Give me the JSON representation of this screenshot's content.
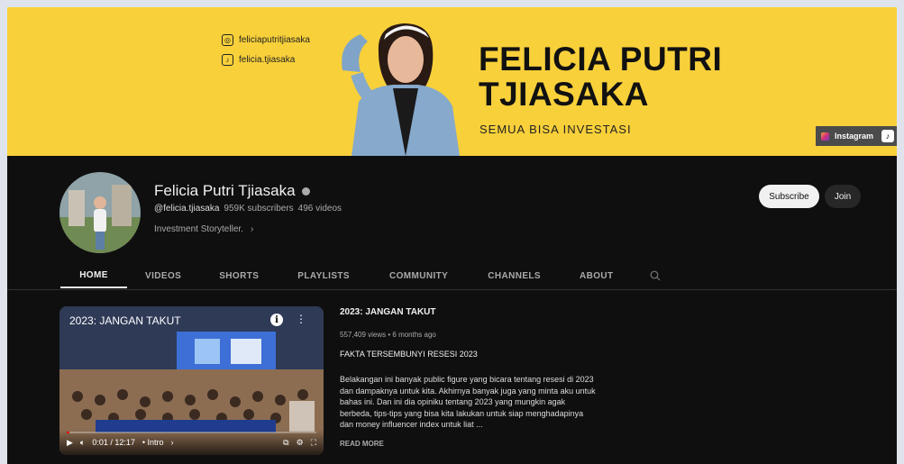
{
  "banner": {
    "instagram_handle": "feliciaputritjiasaka",
    "tiktok_handle": "felicia.tjiasaka",
    "title_line1": "FELICIA PUTRI",
    "title_line2": "TJIASAKA",
    "tagline": "SEMUA BISA INVESTASI",
    "link_label": "Instagram",
    "background_color": "#f8d03a"
  },
  "channel": {
    "name": "Felicia Putri Tjiasaka",
    "handle": "@felicia.tjiasaka",
    "subscribers": "959K subscribers",
    "videos": "496 videos",
    "description": "Investment Storyteller.",
    "subscribe_label": "Subscribe",
    "join_label": "Join"
  },
  "tabs": [
    {
      "label": "HOME",
      "active": true
    },
    {
      "label": "VIDEOS",
      "active": false
    },
    {
      "label": "SHORTS",
      "active": false
    },
    {
      "label": "PLAYLISTS",
      "active": false
    },
    {
      "label": "COMMUNITY",
      "active": false
    },
    {
      "label": "CHANNELS",
      "active": false
    },
    {
      "label": "ABOUT",
      "active": false
    }
  ],
  "featured": {
    "player_title": "2023: JANGAN TAKUT",
    "time": "0:01 / 12:17",
    "chapter": "• Intro",
    "progress": 0.01,
    "title": "2023: JANGAN TAKUT",
    "stats": "557,409 views • 6 months ago",
    "subtitle": "FAKTA TERSEMBUNYI RESESI 2023",
    "description": "Belakangan ini banyak public figure yang bicara tentang resesi di 2023 dan dampaknya untuk kita. Akhirnya banyak juga yang minta aku untuk bahas ini. Dan ini dia opiniku tentang 2023 yang mungkin agak berbeda, tips-tips yang bisa kita lakukan untuk siap menghadapinya dan money influencer index untuk liat ...",
    "read_more": "READ MORE"
  }
}
